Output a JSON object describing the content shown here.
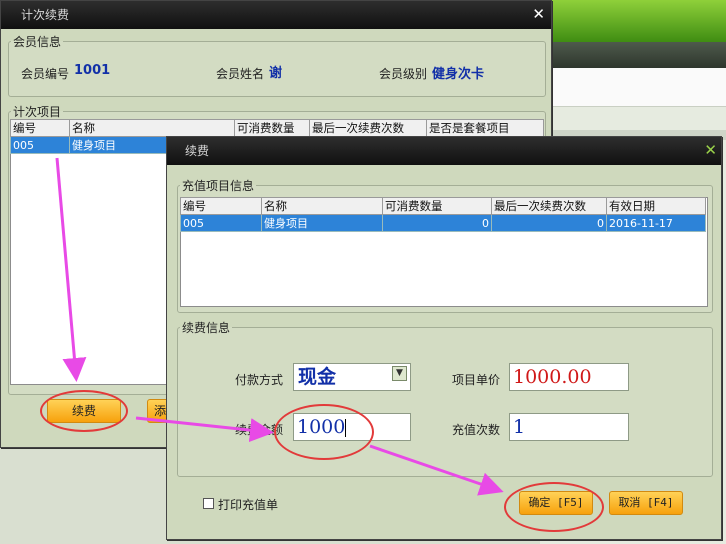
{
  "window_main": {
    "title": "计次续费",
    "member_info": {
      "legend": "会员信息",
      "id_label": "会员编号",
      "id_value": "1001",
      "name_label": "会员姓名",
      "name_value": "谢",
      "level_label": "会员级别",
      "level_value": "健身次卡"
    },
    "count_items": {
      "legend": "计次项目",
      "columns": [
        "编号",
        "名称",
        "可消费数量",
        "最后一次续费次数",
        "是否是套餐项目"
      ],
      "rows": [
        [
          "005",
          "健身项目"
        ]
      ]
    },
    "renew_button": "续费",
    "second_button_partial": "添"
  },
  "window_renew": {
    "title": "续费",
    "recharge_items": {
      "legend": "充值项目信息",
      "columns": [
        "编号",
        "名称",
        "可消费数量",
        "最后一次续费次数",
        "有效日期"
      ],
      "rows": [
        [
          "005",
          "健身项目",
          "0",
          "0",
          "2016-11-17"
        ]
      ]
    },
    "renew_info": {
      "legend": "续费信息",
      "pay_method_label": "付款方式",
      "pay_method_value": "现金",
      "unit_price_label": "项目单价",
      "unit_price_value": "1000.00",
      "amount_label": "续费金额",
      "amount_value": "1000",
      "count_label": "充值次数",
      "count_value": "1"
    },
    "print_checkbox_label": "打印充值单",
    "confirm_button": "确定 [F5]",
    "cancel_button": "取消 [F4]"
  },
  "colors": {
    "annotation_circle": "#e23a3a",
    "annotation_arrow": "#e84ae6",
    "value_text": "#1230a8",
    "price_text": "#d01818",
    "selection": "#2d83d8"
  }
}
